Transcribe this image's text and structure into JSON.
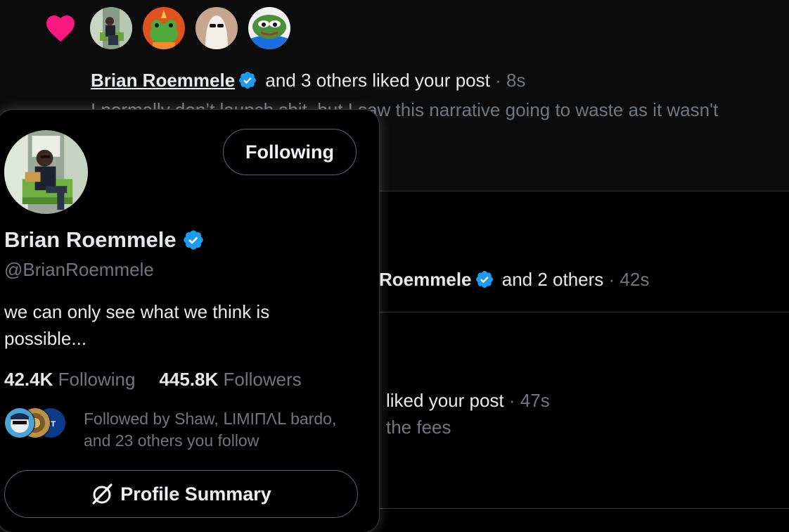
{
  "notifications": [
    {
      "actor": "Brian Roemmele",
      "action": "and 3 others liked your post",
      "time": "· 8s",
      "snippet": "I normally don’t launch shit, but I saw this narrative going to waste as it wasn't"
    },
    {
      "actor": "Roemmele",
      "action": "and 2 others",
      "time": "· 42s"
    },
    {
      "action": "liked your post",
      "time": "· 47s",
      "snippet": "the fees"
    }
  ],
  "card": {
    "follow_label": "Following",
    "name": "Brian Roemmele",
    "handle": "@BrianRoemmele",
    "bio": "we can only see what we think is possible...",
    "following_count": "42.4K",
    "following_label": "Following",
    "followers_count": "445.8K",
    "followers_label": "Followers",
    "followed_by": "Followed by Shaw, ᒪIMIΠΛᒪ bardo, and 23 others you follow",
    "summary_label": "Profile Summary"
  },
  "colors": {
    "background": "#000000",
    "heart": "#f91880",
    "verified": "#1d9bf0",
    "muted_text": "#71767b",
    "primary_text": "#e7e9ea"
  },
  "icons": [
    "heart-icon",
    "verified-badge-icon",
    "grok-slash-icon"
  ]
}
